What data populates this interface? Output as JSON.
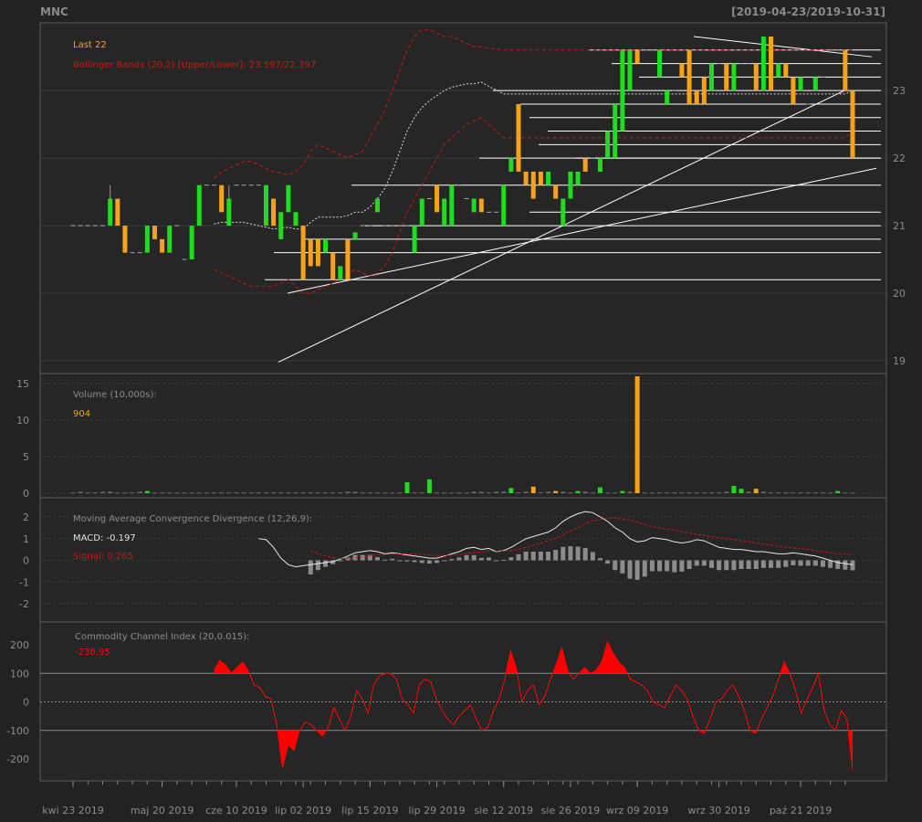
{
  "header": {
    "symbol": "MNC",
    "range": "[2019-04-23/2019-10-31]"
  },
  "colors": {
    "up": "#1fdc1f",
    "down": "#f7a21b",
    "bands": "#d01616",
    "ma": "#dddddd",
    "cci": "#ff0000",
    "panel": "#262626",
    "grid": "#3b3b3b",
    "text": "#8c8c8c"
  },
  "chart_data": [
    {
      "type": "candlestick",
      "title": "MNC",
      "subtitle": "[2019-04-23/2019-10-31]",
      "legend": [
        "Last 22",
        "Bollinger Bands (20,2) [Upper/Lower]: 23.597/22.397"
      ],
      "ylim": [
        18.9,
        24.0
      ],
      "yticks": [
        19,
        20,
        21,
        22,
        23
      ],
      "bb_start_index": 19,
      "x_tick_labels": [
        "kwi 23 2019",
        "maj 20 2019",
        "cze 10 2019",
        "lip 02 2019",
        "lip 15 2019",
        "lip 29 2019",
        "sie 12 2019",
        "sie 26 2019",
        "wrz 09 2019",
        "wrz 30 2019",
        "paź 21 2019"
      ],
      "x_tick_index": [
        0,
        12,
        22,
        31,
        40,
        49,
        58,
        67,
        76,
        87,
        98
      ],
      "close": [
        21.0,
        21.0,
        21.0,
        21.0,
        21.0,
        21.4,
        21.0,
        20.6,
        20.6,
        20.6,
        21.0,
        20.8,
        20.6,
        21.0,
        21.0,
        20.5,
        21.0,
        21.6,
        21.6,
        21.6,
        21.2,
        21.4,
        21.6,
        21.6,
        21.6,
        21.6,
        21.6,
        21.0,
        21.2,
        21.6,
        21.2,
        20.2,
        20.4,
        20.4,
        20.8,
        20.2,
        20.4,
        20.2,
        20.9,
        21.0,
        21.0,
        21.4,
        21.0,
        21.0,
        21.0,
        21.0,
        21.0,
        21.4,
        21.4,
        21.2,
        21.4,
        21.6,
        21.6,
        21.4,
        21.4,
        21.2,
        21.2,
        21.2,
        21.6,
        22.0,
        21.8,
        21.6,
        21.4,
        21.6,
        21.8,
        21.4,
        21.4,
        21.8,
        21.8,
        21.8,
        22.0,
        22.0,
        22.4,
        22.8,
        23.6,
        23.6,
        23.4,
        23.6,
        23.6,
        23.6,
        23.0,
        23.0,
        23.2,
        22.8,
        22.8,
        22.8,
        23.4,
        23.4,
        23.0,
        23.4,
        23.4,
        23.4,
        23.0,
        23.8,
        23.0,
        23.4,
        23.2,
        22.8,
        23.2,
        22.8,
        23.2,
        23.2,
        23.6,
        23.6,
        23.0,
        22.0
      ],
      "open": [
        21.0,
        21.0,
        21.0,
        21.0,
        21.0,
        21.0,
        21.4,
        21.0,
        20.6,
        20.6,
        20.6,
        21.0,
        20.8,
        20.6,
        21.0,
        20.5,
        20.5,
        21.0,
        21.6,
        21.6,
        21.6,
        21.0,
        21.6,
        21.6,
        21.6,
        21.6,
        21.0,
        21.4,
        20.8,
        21.2,
        21.0,
        21.0,
        20.8,
        20.8,
        20.6,
        20.6,
        20.2,
        20.8,
        20.8,
        21.0,
        21.0,
        21.2,
        21.0,
        21.0,
        21.0,
        21.0,
        20.6,
        21.0,
        21.4,
        21.6,
        21.0,
        21.0,
        21.6,
        21.4,
        21.2,
        21.4,
        21.2,
        21.2,
        21.0,
        21.8,
        22.8,
        21.8,
        21.8,
        21.8,
        21.6,
        21.6,
        21.0,
        21.4,
        21.6,
        22.0,
        22.0,
        21.8,
        22.0,
        22.0,
        22.4,
        23.0,
        23.6,
        23.6,
        23.6,
        23.2,
        22.8,
        23.0,
        23.4,
        23.6,
        23.0,
        23.2,
        23.0,
        23.4,
        23.4,
        23.0,
        23.4,
        23.4,
        23.4,
        23.0,
        23.8,
        23.2,
        23.4,
        23.2,
        23.0,
        22.8,
        23.0,
        23.2,
        23.6,
        23.6,
        23.6,
        23.0
      ],
      "high": [
        21.0,
        21.0,
        21.0,
        21.0,
        21.0,
        21.6,
        21.0,
        20.6,
        20.6,
        20.6,
        21.0,
        20.8,
        20.6,
        21.0,
        21.0,
        20.5,
        21.0,
        21.6,
        21.6,
        21.6,
        21.2,
        21.6,
        21.6,
        21.6,
        21.6,
        21.6,
        21.6,
        21.4,
        21.2,
        21.6,
        21.2,
        21.0,
        20.8,
        20.8,
        20.8,
        20.6,
        20.4,
        20.8,
        20.9,
        21.0,
        21.0,
        21.4,
        21.0,
        21.0,
        21.0,
        21.0,
        21.0,
        21.4,
        21.4,
        21.4,
        21.4,
        21.6,
        21.6,
        21.4,
        21.4,
        21.4,
        21.2,
        21.2,
        21.6,
        22.0,
        22.8,
        21.8,
        21.8,
        21.8,
        21.8,
        21.6,
        21.4,
        21.8,
        21.8,
        22.0,
        22.0,
        22.0,
        22.4,
        22.8,
        23.6,
        23.6,
        23.6,
        23.6,
        23.6,
        23.6,
        23.0,
        23.0,
        23.4,
        23.6,
        23.0,
        23.2,
        23.4,
        23.4,
        23.4,
        23.4,
        23.4,
        23.4,
        23.4,
        23.8,
        23.8,
        23.4,
        23.4,
        23.2,
        23.2,
        22.8,
        23.2,
        23.2,
        23.6,
        23.6,
        23.6,
        23.0
      ],
      "low": [
        21.0,
        21.0,
        21.0,
        21.0,
        21.0,
        21.0,
        21.0,
        20.6,
        20.6,
        20.6,
        20.6,
        20.8,
        20.6,
        20.6,
        21.0,
        20.5,
        20.5,
        21.0,
        21.6,
        21.6,
        21.2,
        21.0,
        21.6,
        21.6,
        21.6,
        21.6,
        21.0,
        21.0,
        20.8,
        21.2,
        21.0,
        20.2,
        20.4,
        20.4,
        20.6,
        20.2,
        20.2,
        20.2,
        20.8,
        21.0,
        21.0,
        21.2,
        21.0,
        21.0,
        21.0,
        21.0,
        20.6,
        21.0,
        21.4,
        21.2,
        21.0,
        21.0,
        21.6,
        21.4,
        21.2,
        21.2,
        21.2,
        21.2,
        21.0,
        21.8,
        21.8,
        21.6,
        21.4,
        21.6,
        21.6,
        21.4,
        21.0,
        21.4,
        21.6,
        21.8,
        22.0,
        21.8,
        22.0,
        22.0,
        22.4,
        23.0,
        23.4,
        23.6,
        23.6,
        23.2,
        22.8,
        23.0,
        23.2,
        22.8,
        22.8,
        22.8,
        23.0,
        23.4,
        23.0,
        23.0,
        23.4,
        23.4,
        23.0,
        23.0,
        23.0,
        23.2,
        23.2,
        22.8,
        23.0,
        22.8,
        23.0,
        23.2,
        23.6,
        23.6,
        23.0,
        22.0
      ],
      "bb_upper": [
        21.7,
        21.8,
        21.85,
        21.9,
        21.95,
        21.95,
        21.9,
        21.85,
        21.8,
        21.78,
        21.75,
        21.8,
        21.9,
        22.1,
        22.2,
        22.15,
        22.1,
        22.05,
        22.0,
        22.05,
        22.1,
        22.3,
        22.5,
        22.7,
        23.0,
        23.3,
        23.6,
        23.8,
        23.9,
        23.9,
        23.85,
        23.8,
        23.8,
        23.75,
        23.7,
        23.65,
        23.65,
        23.62,
        23.62,
        23.6,
        23.6,
        23.6,
        23.6,
        23.6,
        23.6,
        23.6,
        23.6,
        23.6,
        23.6,
        23.6,
        23.6,
        23.6,
        23.6,
        23.6,
        23.6,
        23.6,
        23.6,
        23.6,
        23.6,
        23.6,
        23.6,
        23.6,
        23.6,
        23.6,
        23.6,
        23.6,
        23.6,
        23.6,
        23.6,
        23.6,
        23.6,
        23.6,
        23.6,
        23.6,
        23.6,
        23.6,
        23.6,
        23.6,
        23.6,
        23.6,
        23.6,
        23.6,
        23.6,
        23.6,
        23.6,
        23.6,
        23.597
      ],
      "bb_lower": [
        20.35,
        20.3,
        20.25,
        20.2,
        20.15,
        20.1,
        20.1,
        20.1,
        20.1,
        20.15,
        20.2,
        20.1,
        20.0,
        20.0,
        20.05,
        20.1,
        20.15,
        20.2,
        20.3,
        20.35,
        20.3,
        20.25,
        20.3,
        20.4,
        20.6,
        20.9,
        21.2,
        21.4,
        21.6,
        21.8,
        22.0,
        22.2,
        22.3,
        22.4,
        22.5,
        22.55,
        22.6,
        22.5,
        22.4,
        22.3,
        22.3,
        22.3,
        22.3,
        22.3,
        22.3,
        22.3,
        22.3,
        22.3,
        22.3,
        22.3,
        22.3,
        22.3,
        22.3,
        22.3,
        22.3,
        22.3,
        22.3,
        22.3,
        22.3,
        22.3,
        22.3,
        22.3,
        22.3,
        22.3,
        22.3,
        22.3,
        22.3,
        22.3,
        22.3,
        22.3,
        22.3,
        22.3,
        22.3,
        22.3,
        22.3,
        22.3,
        22.3,
        22.3,
        22.3,
        22.3,
        22.3,
        22.3,
        22.3,
        22.3,
        22.3,
        22.3,
        22.397
      ]
    },
    {
      "type": "bar",
      "title": "Volume (10,000s):",
      "last_value": "904",
      "ylim": [
        0,
        16
      ],
      "yticks": [
        0,
        5,
        10,
        15
      ],
      "values": [
        0.1,
        0.2,
        0.1,
        0.1,
        0.2,
        0.2,
        0.1,
        0.1,
        0.1,
        0.2,
        0.3,
        0.1,
        0.1,
        0.1,
        0.1,
        0.1,
        0.1,
        0.1,
        0.1,
        0.1,
        0.1,
        0.1,
        0.1,
        0.1,
        0.1,
        0.1,
        0.1,
        0.1,
        0.1,
        0.1,
        0.1,
        0.1,
        0.1,
        0.1,
        0.1,
        0.1,
        0.1,
        0.2,
        0.2,
        0.1,
        0.1,
        0.1,
        0.1,
        0.1,
        0.1,
        1.5,
        0.1,
        0.1,
        1.9,
        0.1,
        0.1,
        0.1,
        0.1,
        0.1,
        0.2,
        0.2,
        0.1,
        0.2,
        0.2,
        0.7,
        0.1,
        0.2,
        0.9,
        0.1,
        0.2,
        0.3,
        0.2,
        0.1,
        0.3,
        0.2,
        0.1,
        0.8,
        0.1,
        0.1,
        0.3,
        0.2,
        16.0,
        0.1,
        0.1,
        0.1,
        0.1,
        0.1,
        0.1,
        0.1,
        0.1,
        0.1,
        0.1,
        0.1,
        0.2,
        1.0,
        0.6,
        0.2,
        0.6,
        0.2,
        0.1,
        0.1,
        0.1,
        0.1,
        0.1,
        0.1,
        0.1,
        0.1,
        0.1,
        0.3,
        0.1,
        0.1
      ]
    },
    {
      "type": "line",
      "title": "Moving Average Convergence Divergence (12,26,9):",
      "legend": [
        "MACD: -0.197",
        "Signal: 0.265"
      ],
      "ylim": [
        -2.5,
        2.6
      ],
      "yticks": [
        -2,
        -1,
        0,
        1,
        2
      ],
      "start_index": 25,
      "macd": [
        1.0,
        0.95,
        0.6,
        0.1,
        -0.2,
        -0.3,
        -0.25,
        -0.2,
        -0.15,
        -0.1,
        -0.05,
        0.05,
        0.2,
        0.35,
        0.4,
        0.45,
        0.4,
        0.3,
        0.35,
        0.3,
        0.25,
        0.2,
        0.15,
        0.1,
        0.1,
        0.2,
        0.3,
        0.4,
        0.55,
        0.6,
        0.5,
        0.55,
        0.4,
        0.45,
        0.6,
        0.8,
        1.0,
        1.1,
        1.2,
        1.3,
        1.5,
        1.8,
        2.0,
        2.15,
        2.25,
        2.2,
        2.0,
        1.8,
        1.5,
        1.3,
        1.0,
        0.85,
        0.9,
        1.05,
        1.0,
        0.95,
        0.85,
        0.8,
        0.85,
        0.95,
        0.9,
        0.75,
        0.6,
        0.55,
        0.5,
        0.5,
        0.45,
        0.4,
        0.4,
        0.35,
        0.3,
        0.3,
        0.35,
        0.3,
        0.25,
        0.2,
        0.1,
        0.0,
        -0.1,
        -0.15,
        -0.197
      ],
      "signal": [
        null,
        null,
        null,
        null,
        null,
        null,
        null,
        0.45,
        0.3,
        0.2,
        0.12,
        0.08,
        0.07,
        0.1,
        0.15,
        0.2,
        0.25,
        0.27,
        0.28,
        0.3,
        0.3,
        0.28,
        0.27,
        0.25,
        0.22,
        0.22,
        0.24,
        0.27,
        0.31,
        0.36,
        0.39,
        0.42,
        0.42,
        0.43,
        0.46,
        0.52,
        0.6,
        0.7,
        0.8,
        0.9,
        1.02,
        1.18,
        1.35,
        1.52,
        1.68,
        1.82,
        1.9,
        1.95,
        1.95,
        1.9,
        1.85,
        1.75,
        1.65,
        1.55,
        1.5,
        1.45,
        1.4,
        1.32,
        1.25,
        1.2,
        1.15,
        1.1,
        1.05,
        1.0,
        0.95,
        0.9,
        0.85,
        0.8,
        0.75,
        0.7,
        0.65,
        0.6,
        0.58,
        0.55,
        0.5,
        0.45,
        0.4,
        0.35,
        0.3,
        0.28,
        0.265
      ]
    },
    {
      "type": "area",
      "title": "Commodity Channel Index (20,0.015):",
      "last_value": "-238.95",
      "ylim": [
        -270,
        240
      ],
      "yticks": [
        -200,
        -100,
        0,
        100,
        200
      ],
      "ref_lines": [
        100,
        0,
        -100
      ],
      "start_index": 19,
      "values": [
        110,
        145,
        130,
        100,
        120,
        140,
        110,
        60,
        50,
        20,
        10,
        -80,
        -230,
        -150,
        -170,
        -100,
        -70,
        -80,
        -100,
        -120,
        -90,
        -20,
        -60,
        -100,
        -50,
        40,
        10,
        -40,
        60,
        90,
        100,
        100,
        80,
        10,
        -10,
        -40,
        60,
        80,
        70,
        10,
        -30,
        -60,
        -80,
        -50,
        -30,
        -10,
        -60,
        -100,
        -90,
        -30,
        10,
        80,
        180,
        120,
        0,
        40,
        60,
        -10,
        20,
        80,
        130,
        190,
        110,
        80,
        100,
        120,
        100,
        110,
        140,
        210,
        170,
        140,
        120,
        80,
        70,
        60,
        40,
        0,
        -10,
        -20,
        20,
        60,
        40,
        10,
        -50,
        -100,
        -110,
        -60,
        0,
        10,
        40,
        60,
        20,
        -30,
        -100,
        -110,
        -60,
        -20,
        20,
        80,
        140,
        100,
        40,
        -40,
        10,
        50,
        100,
        -30,
        -80,
        -100,
        -30,
        -60,
        -238.95
      ]
    }
  ]
}
